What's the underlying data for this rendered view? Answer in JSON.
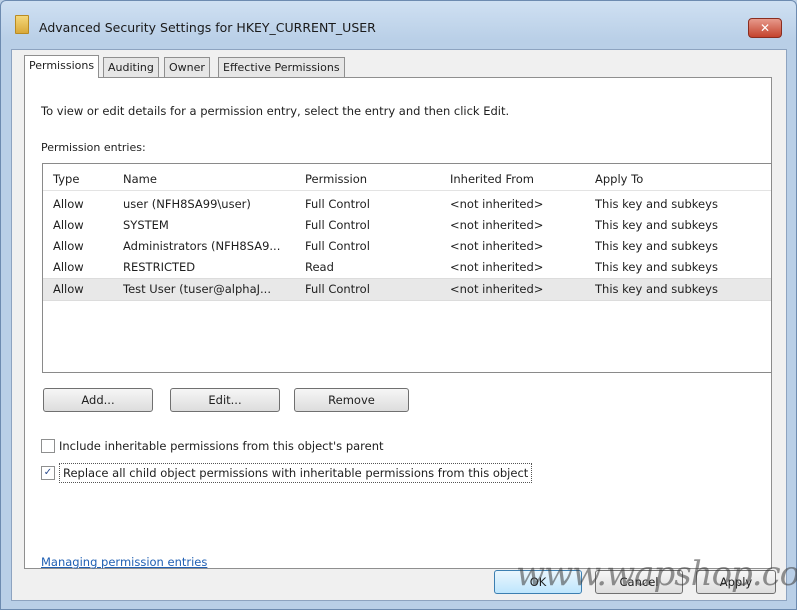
{
  "window": {
    "title": "Advanced Security Settings for HKEY_CURRENT_USER",
    "close_label": "✕"
  },
  "tabs": [
    {
      "label": "Permissions",
      "active": true
    },
    {
      "label": "Auditing",
      "active": false
    },
    {
      "label": "Owner",
      "active": false
    },
    {
      "label": "Effective Permissions",
      "active": false
    }
  ],
  "instructions": "To view or edit details for a permission entry, select the entry and then click Edit.",
  "entries_label": "Permission entries:",
  "columns": [
    "Type",
    "Name",
    "Permission",
    "Inherited From",
    "Apply To"
  ],
  "rows": [
    {
      "type": "Allow",
      "name": "user (NFH8SA99\\user)",
      "permission": "Full Control",
      "inherited": "<not inherited>",
      "apply": "This key and subkeys",
      "selected": false
    },
    {
      "type": "Allow",
      "name": "SYSTEM",
      "permission": "Full Control",
      "inherited": "<not inherited>",
      "apply": "This key and subkeys",
      "selected": false
    },
    {
      "type": "Allow",
      "name": "Administrators (NFH8SA9...",
      "permission": "Full Control",
      "inherited": "<not inherited>",
      "apply": "This key and subkeys",
      "selected": false
    },
    {
      "type": "Allow",
      "name": "RESTRICTED",
      "permission": "Read",
      "inherited": "<not inherited>",
      "apply": "This key and subkeys",
      "selected": false
    },
    {
      "type": "Allow",
      "name": "Test User (tuser@alphaJ...",
      "permission": "Full Control",
      "inherited": "<not inherited>",
      "apply": "This key and subkeys",
      "selected": true
    }
  ],
  "buttons": {
    "add": "Add...",
    "edit": "Edit...",
    "remove": "Remove"
  },
  "checkboxes": {
    "include_inheritable": {
      "label": "Include inheritable permissions from this object's parent",
      "checked": false
    },
    "replace_child": {
      "label": "Replace all child object permissions with inheritable permissions from this object",
      "checked": true
    }
  },
  "link": "Managing permission entries",
  "dialog_buttons": {
    "ok": "OK",
    "cancel": "Cancel",
    "apply": "Apply"
  },
  "watermark": "www.wapshop.com",
  "colors": {
    "link": "#1f5fb3",
    "selection": "#e8e8e8",
    "close": "#c4432d"
  }
}
